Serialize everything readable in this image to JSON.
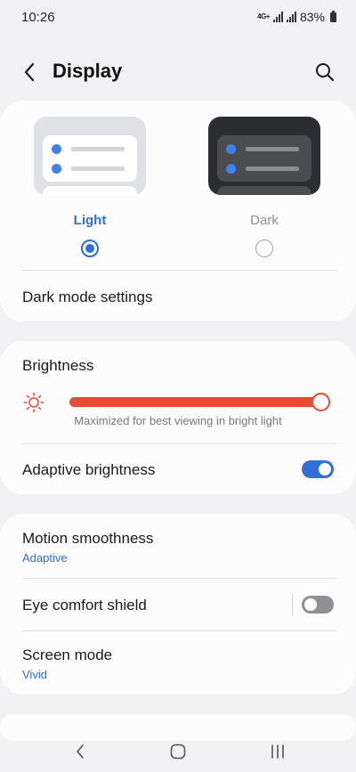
{
  "status_bar": {
    "time": "10:26",
    "network": "4G+",
    "battery": "83%"
  },
  "header": {
    "title": "Display",
    "back_icon": "chevron-left-icon",
    "search_icon": "search-icon"
  },
  "theme": {
    "light_label": "Light",
    "dark_label": "Dark",
    "selected": "Light",
    "dark_mode_settings_label": "Dark mode settings"
  },
  "brightness": {
    "label": "Brightness",
    "level_fraction": 1.0,
    "caption": "Maximized for best viewing in bright light",
    "adaptive_label": "Adaptive brightness",
    "adaptive_on": true
  },
  "settings": {
    "motion_label": "Motion smoothness",
    "motion_value": "Adaptive",
    "eye_comfort_label": "Eye comfort shield",
    "eye_comfort_on": false,
    "screen_mode_label": "Screen mode",
    "screen_mode_value": "Vivid"
  },
  "colors": {
    "accent": "#2f6fd8",
    "slider": "#ea4a33",
    "background": "#f2f2f4",
    "card": "#fcfcfc"
  },
  "navbar": {
    "back_icon": "nav-back-icon",
    "home_icon": "nav-home-icon",
    "recents_icon": "nav-recents-icon"
  }
}
